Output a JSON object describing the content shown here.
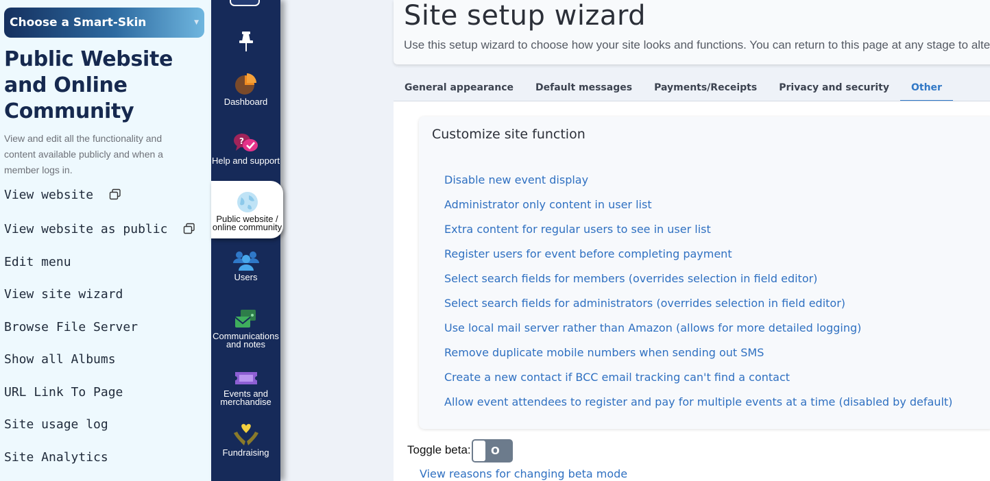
{
  "left_panel": {
    "skin_select": {
      "value": "Choose a Smart-Skin",
      "arrow": "chevron-down-icon"
    },
    "title": "Public Website and Online Community",
    "description": "View and edit all the functionality and content available publicly and when a member logs in.",
    "menu": [
      {
        "label": "View website",
        "icon": "external-window-icon"
      },
      {
        "label": "View website as public",
        "icon": "external-window-icon"
      },
      {
        "label": "Edit menu"
      },
      {
        "label": "View site wizard"
      },
      {
        "label": "Browse File Server"
      },
      {
        "label": "Show all Albums"
      },
      {
        "label": "URL Link To Page"
      },
      {
        "label": "Site usage log"
      },
      {
        "label": "Site Analytics"
      }
    ]
  },
  "sidebar": {
    "items": [
      {
        "label": "",
        "icon": "notes-icon"
      },
      {
        "label": "",
        "icon": "pin-icon"
      },
      {
        "label": "Dashboard",
        "icon": "pie-chart-icon"
      },
      {
        "label": "Help and support",
        "icon": "chat-bubbles-icon"
      },
      {
        "label": "Public website / online community",
        "icon": "globe-icon",
        "active": true
      },
      {
        "label": "Users",
        "icon": "users-icon"
      },
      {
        "label": "Communications and notes",
        "icon": "envelope-icon"
      },
      {
        "label": "Events and merchandise",
        "icon": "ticket-icon"
      },
      {
        "label": "Fundraising",
        "icon": "heart-hands-icon"
      }
    ]
  },
  "header": {
    "title": "Site setup wizard",
    "subtitle": "Use this setup wizard to choose how your site looks and functions. You can return to this page at any stage to alter"
  },
  "tabs": [
    {
      "label": "General appearance"
    },
    {
      "label": "Default messages"
    },
    {
      "label": "Payments/Receipts"
    },
    {
      "label": "Privacy and security"
    },
    {
      "label": "Other",
      "active": true
    }
  ],
  "section": {
    "title": "Customize site function",
    "links": [
      "Disable new event display",
      "Administrator only content in user list",
      "Extra content for regular users to see in user list",
      "Register users for event before completing payment",
      "Select search fields for members (overrides selection in field editor)",
      "Select search fields for administrators (overrides selection in field editor)",
      "Use local mail server rather than Amazon (allows for more detailed logging)",
      "Remove duplicate mobile numbers when sending out SMS",
      "Create a new contact if BCC email tracking can't find a contact",
      "Allow event attendees to register and pay for multiple events at a time (disabled by default)"
    ]
  },
  "beta": {
    "label": "Toggle beta:",
    "state": "O",
    "link": "View reasons for changing beta mode"
  },
  "colors": {
    "sidebar_bg": "#162a59",
    "left_panel_bg": "#eef9fe",
    "link": "#2f70c1",
    "active_tab": "#3178c6",
    "title": "#16294f"
  }
}
